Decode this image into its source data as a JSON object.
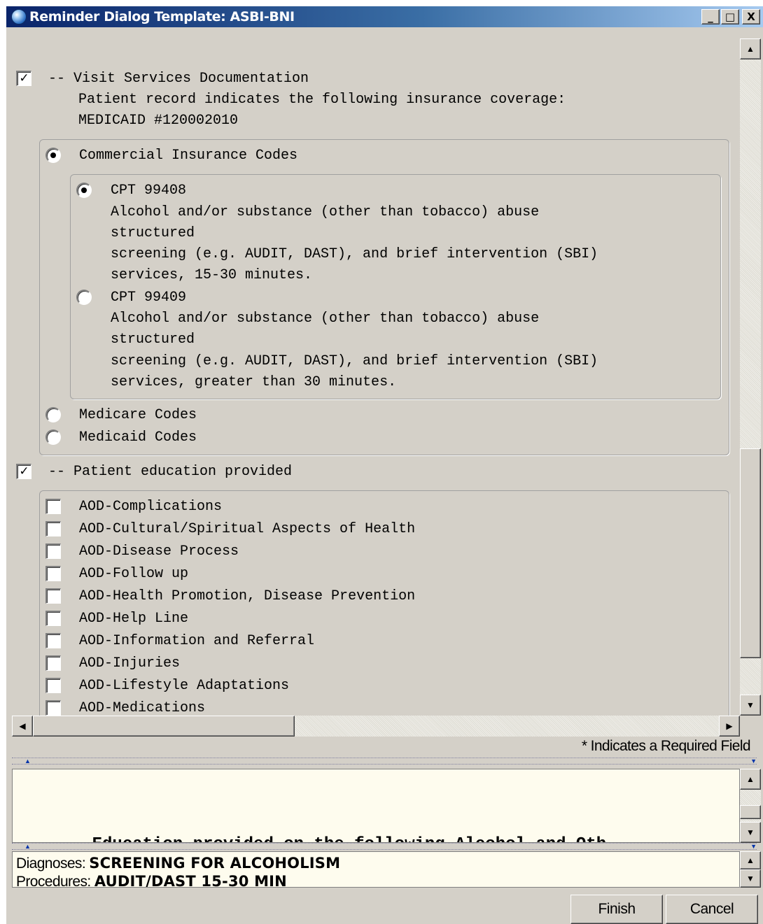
{
  "window": {
    "title": "Reminder Dialog Template: ASBI-BNI",
    "min_glyph": "_",
    "max_glyph": "□",
    "close_glyph": "X"
  },
  "sections": {
    "visit": {
      "checked": true,
      "label": "-- Visit Services Documentation",
      "note_line1": "Patient record indicates the following insurance coverage:",
      "note_line2": "MEDICAID #120002010"
    },
    "insurance_options": [
      {
        "label": "Commercial Insurance Codes",
        "selected": true
      },
      {
        "label": "Medicare Codes",
        "selected": false
      },
      {
        "label": "Medicaid Codes",
        "selected": false
      }
    ],
    "cpt_options": [
      {
        "selected": true,
        "lines": [
          "CPT 99408",
          "Alcohol and/or substance (other than tobacco) abuse",
          "structured",
          "screening (e.g. AUDIT, DAST), and brief intervention (SBI)",
          "services, 15-30 minutes."
        ]
      },
      {
        "selected": false,
        "lines": [
          "CPT 99409",
          "Alcohol and/or substance (other than tobacco) abuse",
          "structured",
          "screening (e.g. AUDIT, DAST), and brief intervention (SBI)",
          "services, greater than 30 minutes."
        ]
      }
    ],
    "education": {
      "checked": true,
      "label": "-- Patient education provided",
      "items": [
        {
          "label": "AOD-Complications",
          "checked": false
        },
        {
          "label": "AOD-Cultural/Spiritual Aspects of Health",
          "checked": false
        },
        {
          "label": "AOD-Disease Process",
          "checked": false
        },
        {
          "label": "AOD-Follow up",
          "checked": false
        },
        {
          "label": "AOD-Health Promotion, Disease Prevention",
          "checked": false
        },
        {
          "label": "AOD-Help Line",
          "checked": false
        },
        {
          "label": "AOD-Information and Referral",
          "checked": false
        },
        {
          "label": "AOD-Injuries",
          "checked": false
        },
        {
          "label": "AOD-Lifestyle Adaptations",
          "checked": false
        },
        {
          "label": "AOD-Medications",
          "checked": false
        }
      ]
    }
  },
  "required_note": "* Indicates a Required Field",
  "preview": {
    "partial_text": "    Education provided on the following Alcohol and Oth"
  },
  "summary": {
    "diagnoses_label": "Diagnoses: ",
    "diagnoses_value": "SCREENING FOR ALCOHOLISM",
    "procedures_label": "Procedures: ",
    "procedures_value": "AUDIT/DAST 15-30 MIN"
  },
  "buttons": {
    "finish": "Finish",
    "cancel": "Cancel"
  }
}
